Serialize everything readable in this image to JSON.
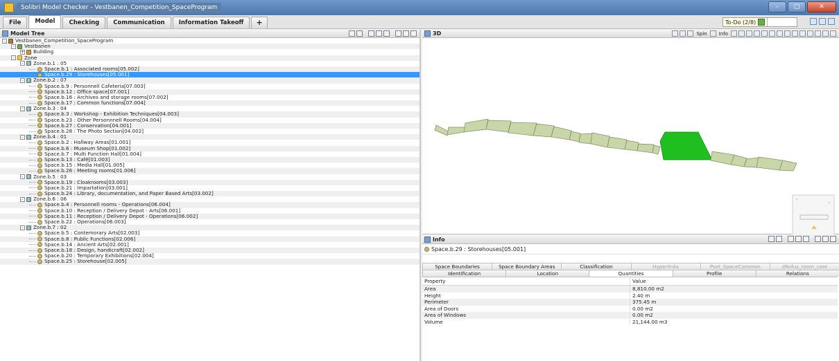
{
  "window": {
    "title": "Solibri Model Checker - Vestbanen_Competition_SpaceProgram"
  },
  "menu_tabs": [
    "File",
    "Model",
    "Checking",
    "Communication",
    "Information Takeoff",
    "+"
  ],
  "todo": {
    "label": "To-Do (2/8)"
  },
  "model_tree": {
    "title": "Model Tree",
    "rows": [
      {
        "label": "Vestbanen_Competition_SpaceProgram",
        "level": 0,
        "icon": "project-icon",
        "expander": "-"
      },
      {
        "label": "Vestbanen",
        "level": 1,
        "icon": "site-icon",
        "expander": "-"
      },
      {
        "label": "Building",
        "level": 2,
        "icon": "building-icon",
        "expander": "+"
      },
      {
        "label": "Zone",
        "level": 1,
        "icon": "zone-folder-icon",
        "expander": "-"
      },
      {
        "label": "Zone.b.1 : 05",
        "level": 2,
        "icon": "zone-icon",
        "expander": "-"
      },
      {
        "label": "Space.b.1 : Associated rooms[05.002]",
        "level": 3,
        "icon": "space-icon"
      },
      {
        "label": "Space.b.29 : Storehouses[05.001]",
        "level": 3,
        "icon": "space-icon",
        "selected": true
      },
      {
        "label": "Zone.b.2 : 07",
        "level": 2,
        "icon": "zone-icon",
        "expander": "-"
      },
      {
        "label": "Space.b.9 : Personnell Cafeteria[07.003]",
        "level": 3,
        "icon": "space-icon"
      },
      {
        "label": "Space.b.12 : Office space[07.001]",
        "level": 3,
        "icon": "space-icon"
      },
      {
        "label": "Space.b.16 : Archives and storage rooms[07.002]",
        "level": 3,
        "icon": "space-icon"
      },
      {
        "label": "Space.b.17 : Common functions[07.004]",
        "level": 3,
        "icon": "space-icon"
      },
      {
        "label": "Zone.b.3 : 04",
        "level": 2,
        "icon": "zone-icon",
        "expander": "-"
      },
      {
        "label": "Space.b.3 : Workshop - Exhibition Techniques[04.003]",
        "level": 3,
        "icon": "space-icon"
      },
      {
        "label": "Space.b.23 : Other Personnnell Rooms[04.004]",
        "level": 3,
        "icon": "space-icon"
      },
      {
        "label": "Space.b.27 : Conservation[04.001]",
        "level": 3,
        "icon": "space-icon"
      },
      {
        "label": "Space.b.28 : The Photo Section[04.002]",
        "level": 3,
        "icon": "space-icon"
      },
      {
        "label": "Zone.b.4 : 01",
        "level": 2,
        "icon": "zone-icon",
        "expander": "-"
      },
      {
        "label": "Space.b.2 : Hallway Areas[01.001]",
        "level": 3,
        "icon": "space-icon"
      },
      {
        "label": "Space.b.6 : Museum Shop[01.002]",
        "level": 3,
        "icon": "space-icon"
      },
      {
        "label": "Space.b.7 : Multi Function Hall[01.004]",
        "level": 3,
        "icon": "space-icon"
      },
      {
        "label": "Space.b.13 : Café[01.003]",
        "level": 3,
        "icon": "space-icon"
      },
      {
        "label": "Space.b.15 : Media Hall[01.005]",
        "level": 3,
        "icon": "space-icon"
      },
      {
        "label": "Space.b.26 : Meeting rooms[01.006]",
        "level": 3,
        "icon": "space-icon"
      },
      {
        "label": "Zone.b.5 : 03",
        "level": 2,
        "icon": "zone-icon",
        "expander": "-"
      },
      {
        "label": "Space.b.19 : Cloakrooms[03.003]",
        "level": 3,
        "icon": "space-icon"
      },
      {
        "label": "Space.b.21 : Impartation[03.001]",
        "level": 3,
        "icon": "space-icon"
      },
      {
        "label": "Space.b.24 : Library, documentation, and Paper Based Arts[03.002]",
        "level": 3,
        "icon": "space-icon"
      },
      {
        "label": "Zone.b.6 : 06",
        "level": 2,
        "icon": "zone-icon",
        "expander": "-"
      },
      {
        "label": "Space.b.4 : Personnell rooms - Operations[06.004]",
        "level": 3,
        "icon": "space-icon"
      },
      {
        "label": "Space.b.10 : Reception / Delivery Depot - Arts[06.001]",
        "level": 3,
        "icon": "space-icon"
      },
      {
        "label": "Space.b.11 : Reception / Delivery Depot - Operations[06.002]",
        "level": 3,
        "icon": "space-icon"
      },
      {
        "label": "Space.b.22 : Operations[06.003]",
        "level": 3,
        "icon": "space-icon"
      },
      {
        "label": "Zone.b.7 : 02",
        "level": 2,
        "icon": "zone-icon",
        "expander": "-"
      },
      {
        "label": "Space.b.5 : Contemorary Arts[02.003]",
        "level": 3,
        "icon": "space-icon"
      },
      {
        "label": "Space.b.8 : Public Functions[02.006]",
        "level": 3,
        "icon": "space-icon"
      },
      {
        "label": "Space.b.14 : Ancient Arts[02.001]",
        "level": 3,
        "icon": "space-icon"
      },
      {
        "label": "Space.b.18 : Design, handicraft[02.002]",
        "level": 3,
        "icon": "space-icon"
      },
      {
        "label": "Space.b.20 : Temporary Exhibitions[02.004]",
        "level": 3,
        "icon": "space-icon"
      },
      {
        "label": "Space.b.25 : Storehouse[02.005]",
        "level": 3,
        "icon": "space-icon"
      }
    ]
  },
  "view3d": {
    "title": "3D",
    "toolbar": {
      "spin_label": "Spin",
      "info_label": "Info"
    },
    "colors": {
      "space_fill": "#c8d6a8",
      "space_edge": "#7c8c62",
      "selected_fill": "#1fbf1f"
    }
  },
  "info": {
    "title": "Info",
    "selected": "Space.b.29 : Storehouses[05.001]",
    "tabs_row1": [
      {
        "label": "Space Boundaries"
      },
      {
        "label": "Space Boundary Areas"
      },
      {
        "label": "Classification"
      },
      {
        "label": "Hyperlinks",
        "disabled": true
      },
      {
        "label": "Pset_SpaceCommon",
        "disabled": true
      },
      {
        "label": "dRofus_room_core",
        "disabled": true
      }
    ],
    "tabs_row2": [
      {
        "label": "Identification"
      },
      {
        "label": "Location"
      },
      {
        "label": "Quantities",
        "active": true
      },
      {
        "label": "Profile"
      },
      {
        "label": "Relations"
      }
    ],
    "table": {
      "col_property": "Property",
      "col_value": "Value",
      "rows": [
        {
          "property": "Area",
          "value": "8,810.00 m2"
        },
        {
          "property": "Height",
          "value": "2.40 m"
        },
        {
          "property": "Perimeter",
          "value": "375.45 m"
        },
        {
          "property": "Area of Doors",
          "value": "0.00 m2"
        },
        {
          "property": "Area of Windows",
          "value": "0.00 m2"
        },
        {
          "property": "Volume",
          "value": "21,144.00 m3"
        }
      ]
    }
  }
}
